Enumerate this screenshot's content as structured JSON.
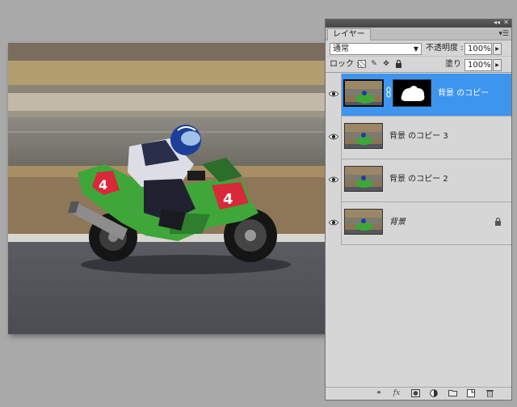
{
  "panel": {
    "tab_label": "レイヤー",
    "blend_mode": "通常",
    "opacity_label": "不透明度 :",
    "opacity_value": "100%",
    "lock_label": "ロック :",
    "fill_label": "塗り :",
    "fill_value": "100%"
  },
  "layers": [
    {
      "name": "背景 のコピー",
      "selected": true,
      "has_mask": true,
      "locked": false
    },
    {
      "name": "背景 のコピー 3",
      "selected": false,
      "has_mask": false,
      "locked": false
    },
    {
      "name": "背景 のコピー 2",
      "selected": false,
      "has_mask": false,
      "locked": false
    },
    {
      "name": "背景",
      "selected": false,
      "has_mask": false,
      "locked": true
    }
  ],
  "photo": {
    "number_plate": "4"
  },
  "colors": {
    "selected_row": "#3d95f0",
    "bike_green": "#3fa63a",
    "bike_red": "#d8293a"
  },
  "icons": {
    "lock_options": [
      "transparency-lock-icon",
      "brush-lock-icon",
      "move-lock-icon",
      "padlock-icon"
    ],
    "bottom_bar": [
      "link-layers-icon",
      "fx-icon",
      "add-mask-icon",
      "adjustment-layer-icon",
      "new-group-icon",
      "new-layer-icon",
      "trash-icon"
    ]
  }
}
